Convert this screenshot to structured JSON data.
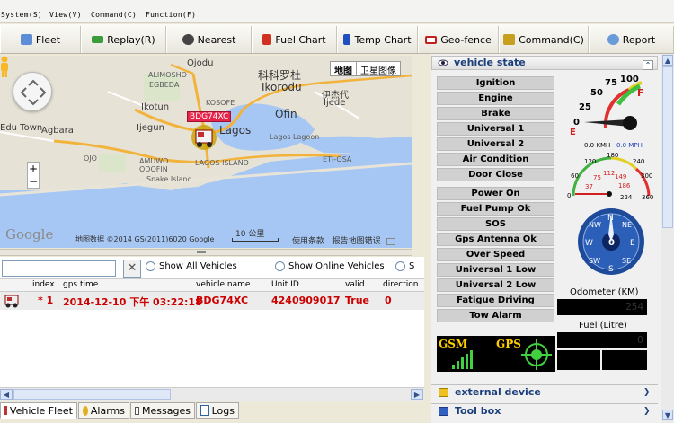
{
  "menu": [
    "System(S)",
    "View(V)",
    "Command(C)",
    "Function(F)"
  ],
  "toolbar": {
    "fleet": "Fleet",
    "replay": "Replay(R)",
    "nearest": "Nearest",
    "fuel_chart": "Fuel Chart",
    "temp_chart": "Temp Chart",
    "geofence": "Geo-fence",
    "command": "Command(C)",
    "report": "Report"
  },
  "map": {
    "type_map": "地图",
    "type_satellite": "卫星图像",
    "vehicle_tag": "BDG74XC",
    "labels": {
      "ojodu": "Ojodu",
      "cn_kekeduocun": "科科罗杜",
      "ikorodu": "Ikorodu",
      "alimosho": "ALIMOSHO",
      "egbeda": "EGBEDA",
      "ikotun": "Ikotun",
      "kosofe": "KOSOFE",
      "cn_yijie": "伊杰代",
      "ijede": "Ijede",
      "edu_town": "Edu Town",
      "agbara": "Agbara",
      "ijegun": "Ijegun",
      "ofin": "Ofin",
      "lagos": "Lagos",
      "lagos_lagoon": "Lagos Lagoon",
      "ojo": "OJO",
      "amuwo": "AMUWO",
      "odofin": "ODOFIN",
      "lagos_island": "LAGOS ISLAND",
      "eti_osa": "ETI-OSA",
      "snake_island": "Snake Island"
    },
    "google": "Google",
    "footer": "地图数据 ©2014 GS(2011)6020 Google",
    "scale": "10 公里",
    "terms": "使用条款",
    "report_error": "报告地图错误"
  },
  "filter": {
    "show_all": "Show All Vehicles",
    "show_online": "Show Online Vehicles",
    "third": "S"
  },
  "grid": {
    "headers": [
      "index",
      "gps time",
      "vehicle name",
      "Unit ID",
      "valid",
      "direction"
    ],
    "rows": [
      {
        "index": "* 1",
        "gps_time": "2014-12-10 下午 03:22:18",
        "vehicle_name": "BDG74XC",
        "unit_id": "4240909017",
        "valid": "True",
        "direction": "0"
      }
    ]
  },
  "bottom_tabs": [
    "Vehicle Fleet",
    "Alarms",
    "Messages",
    "Logs"
  ],
  "right_panel": {
    "title": "vehicle state",
    "status_items": [
      "Ignition",
      "Engine",
      "Brake",
      "Universal 1",
      "Universal 2",
      "Air Condition",
      "Door Close",
      "Power On",
      "Fuel Pump Ok",
      "SOS",
      "Gps Antenna Ok",
      "Over Speed",
      "Universal 1 Low",
      "Universal 2 Low",
      "Fatigue Driving",
      "Tow Alarm"
    ],
    "fuel_gauge": {
      "labels": [
        "0",
        "25",
        "50",
        "75",
        "100"
      ],
      "e": "E",
      "f": "F"
    },
    "speed_gauge": {
      "labels": [
        "0",
        "37",
        "60",
        "75",
        "112",
        "120",
        "149",
        "180",
        "186",
        "224",
        "240",
        "300",
        "360"
      ],
      "unit_kmh": "0.0 KMH",
      "unit_mph": "0.0 MPH"
    },
    "compass": {
      "n": "N",
      "ne": "NE",
      "e": "E",
      "se": "SE",
      "s": "S",
      "sw": "SW",
      "w": "W",
      "nw": "NW",
      "heading": "0"
    },
    "odometer_label": "Odometer (KM)",
    "odometer_value": "254",
    "fuel_label": "Fuel (Litre)",
    "fuel_value": "0",
    "gsm": "GSM",
    "gps": "GPS",
    "external_device": "external device",
    "tool_box": "Tool box"
  }
}
